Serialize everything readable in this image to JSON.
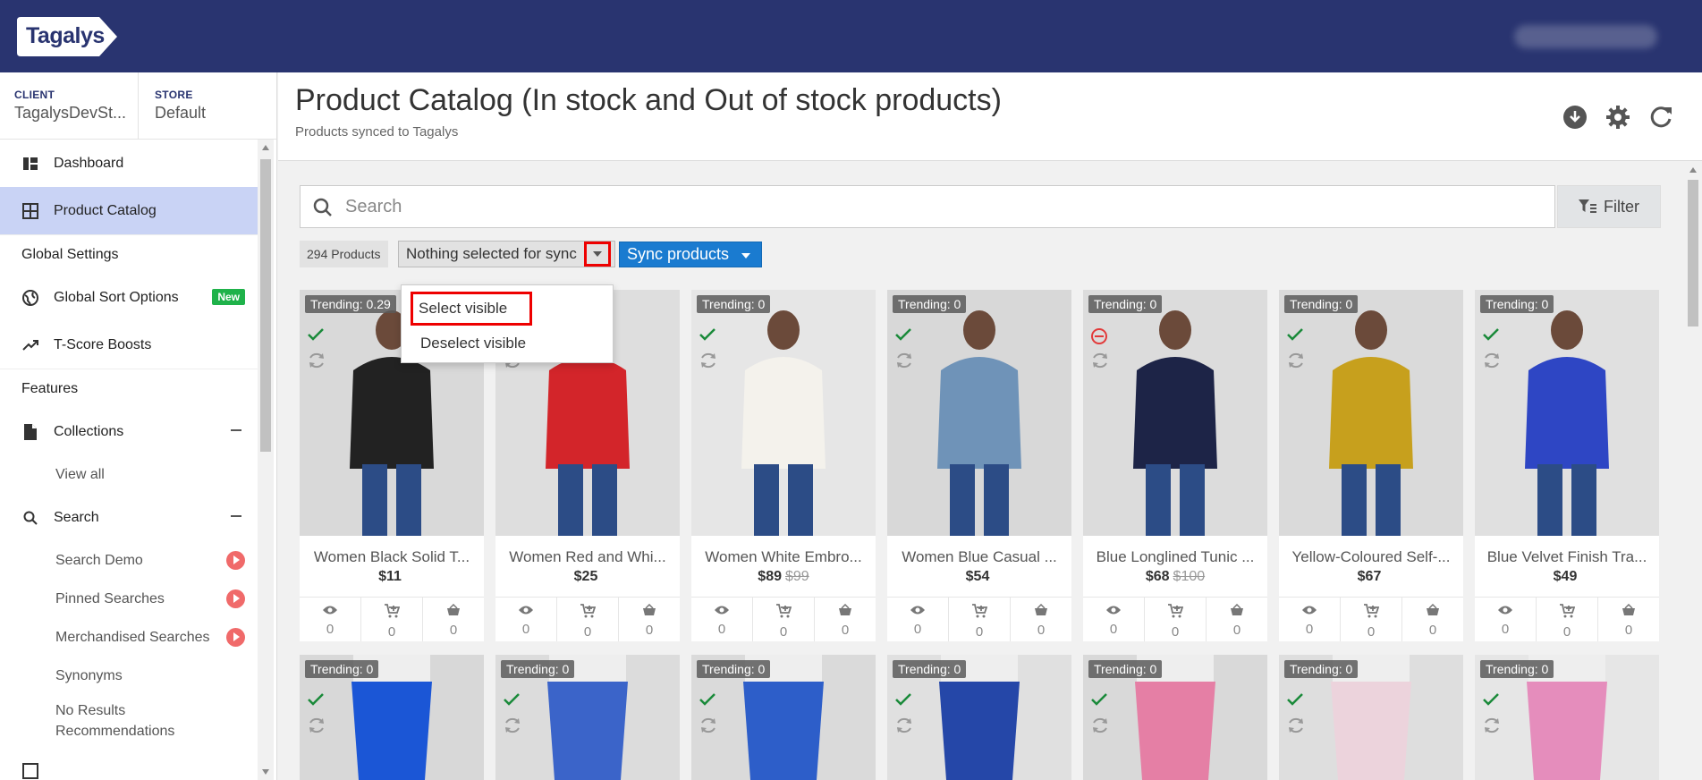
{
  "app": {
    "logo_text": "Tagalys"
  },
  "sidebar": {
    "client_label": "CLIENT",
    "client_value": "TagalysDevSt...",
    "store_label": "STORE",
    "store_value": "Default",
    "items": [
      {
        "label": "Dashboard"
      },
      {
        "label": "Product Catalog"
      },
      {
        "label": "Global Settings"
      },
      {
        "label": "Global Sort Options",
        "badge": "New"
      },
      {
        "label": "T-Score Boosts"
      },
      {
        "label": "Features"
      },
      {
        "label": "Collections"
      },
      {
        "label": "View all"
      },
      {
        "label": "Search"
      },
      {
        "label": "Search Demo"
      },
      {
        "label": "Pinned Searches"
      },
      {
        "label": "Merchandised Searches"
      },
      {
        "label": "Synonyms"
      },
      {
        "label": "No Results Recommendations"
      }
    ]
  },
  "header": {
    "title": "Product Catalog (In stock and Out of stock products)",
    "subtitle": "Products synced to Tagalys"
  },
  "search": {
    "placeholder": "Search"
  },
  "filter": {
    "label": "Filter"
  },
  "toolbar": {
    "count": "294 Products",
    "sync_select": "Nothing selected for sync",
    "sync_button": "Sync products"
  },
  "dropdown": {
    "items": [
      "Select visible",
      "Deselect visible"
    ]
  },
  "products": [
    {
      "trending": "Trending: 0.29",
      "status": "check",
      "name": "Women Black Solid T...",
      "price": "$11",
      "old_price": "",
      "views": "0",
      "cart": "0",
      "orders": "0"
    },
    {
      "trending": "Trending: 0",
      "status": "check",
      "name": "Women Red and Whi...",
      "price": "$25",
      "old_price": "",
      "views": "0",
      "cart": "0",
      "orders": "0"
    },
    {
      "trending": "Trending: 0",
      "status": "check",
      "name": "Women White Embro...",
      "price": "$89",
      "old_price": "$99",
      "views": "0",
      "cart": "0",
      "orders": "0"
    },
    {
      "trending": "Trending: 0",
      "status": "check",
      "name": "Women Blue Casual ...",
      "price": "$54",
      "old_price": "",
      "views": "0",
      "cart": "0",
      "orders": "0"
    },
    {
      "trending": "Trending: 0",
      "status": "blocked",
      "name": "Blue Longlined Tunic ...",
      "price": "$68",
      "old_price": "$100",
      "views": "0",
      "cart": "0",
      "orders": "0"
    },
    {
      "trending": "Trending: 0",
      "status": "check",
      "name": "Yellow-Coloured Self-...",
      "price": "$67",
      "old_price": "",
      "views": "0",
      "cart": "0",
      "orders": "0"
    },
    {
      "trending": "Trending: 0",
      "status": "check",
      "name": "Blue Velvet Finish Tra...",
      "price": "$49",
      "old_price": "",
      "views": "0",
      "cart": "0",
      "orders": "0"
    }
  ],
  "products_row2": [
    {
      "trending": "Trending: 0"
    },
    {
      "trending": "Trending: 0"
    },
    {
      "trending": "Trending: 0"
    },
    {
      "trending": "Trending: 0"
    },
    {
      "trending": "Trending: 0"
    },
    {
      "trending": "Trending: 0"
    },
    {
      "trending": "Trending: 0"
    }
  ],
  "colors": {
    "topbar": "#293470",
    "accent_blue": "#1a7bd0",
    "active_nav": "#c9d3f5",
    "status_green": "#1a8a3a",
    "status_red": "#e23a3a",
    "highlight_red": "#ee0000"
  }
}
